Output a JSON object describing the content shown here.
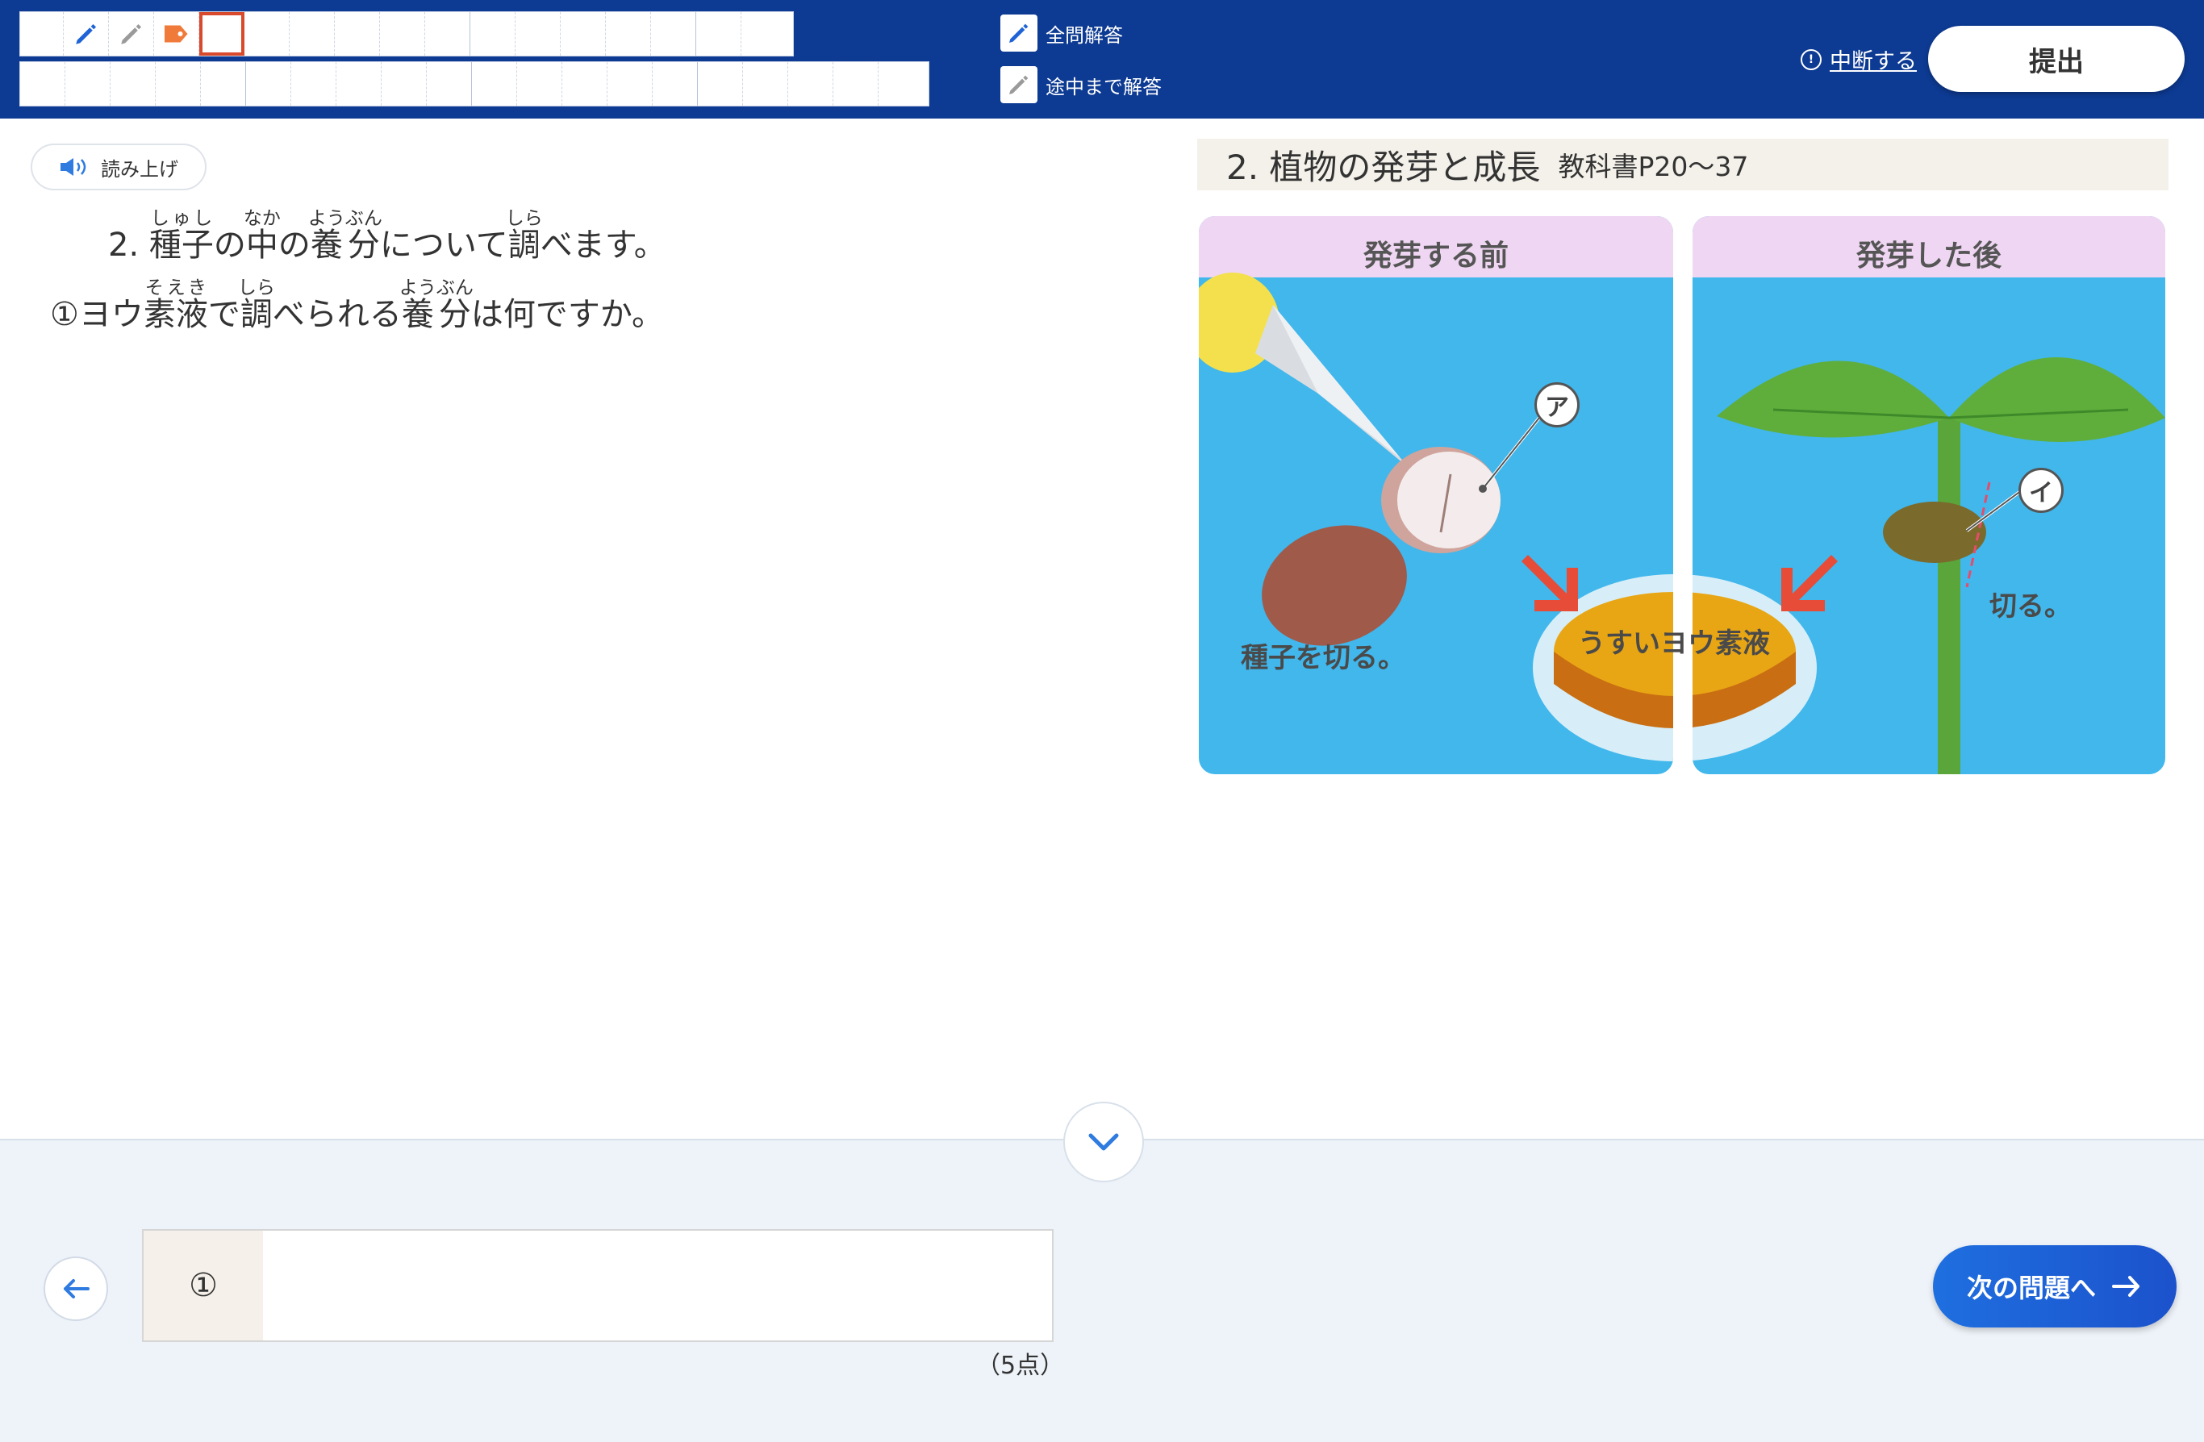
{
  "header": {
    "toolbar_icons": [
      "pencil-blue-icon",
      "pencil-gray-icon",
      "tag-orange-icon"
    ],
    "answer_all_label": "全問解答",
    "answer_partial_label": "途中まで解答",
    "suspend_label": "中断する",
    "submit_label": "提出"
  },
  "question": {
    "read_aloud_label": "読み上げ",
    "line1": {
      "prefix": "2. ",
      "w1": "種子",
      "r1": "しゅし",
      "t2": "の",
      "w2": "中",
      "r2": "なか",
      "t3": "の",
      "w3": "養分",
      "r3": "ようぶん",
      "t4": "について",
      "w4": "調",
      "r4": "しら",
      "t5": "べます。"
    },
    "line2": {
      "prefix": "①ヨウ",
      "w1": "素液",
      "r1": "そえき",
      "t2": "で",
      "w2": "調",
      "r2": "しら",
      "t3": "べられる",
      "w3": "養分",
      "r3": "ようぶん",
      "t4": "は何ですか。"
    }
  },
  "reference": {
    "title": "2. 植物の発芽と成長",
    "textbook": "教科書P20～37",
    "panel_left_title": "発芽する前",
    "panel_right_title": "発芽した後",
    "label_a": "ア",
    "label_i": "イ",
    "cut_seed": "種子を切る。",
    "iodine": "うすいヨウ素液",
    "cut": "切る。"
  },
  "answer": {
    "number": "①",
    "value": "",
    "points": "（5点）"
  },
  "nav": {
    "next_label": "次の問題へ"
  },
  "colors": {
    "header_bg": "#0d3a92",
    "next_button": "#1e6fe0",
    "selected_cell_border": "#d9492b",
    "bottom_bg": "#eef3f9"
  }
}
